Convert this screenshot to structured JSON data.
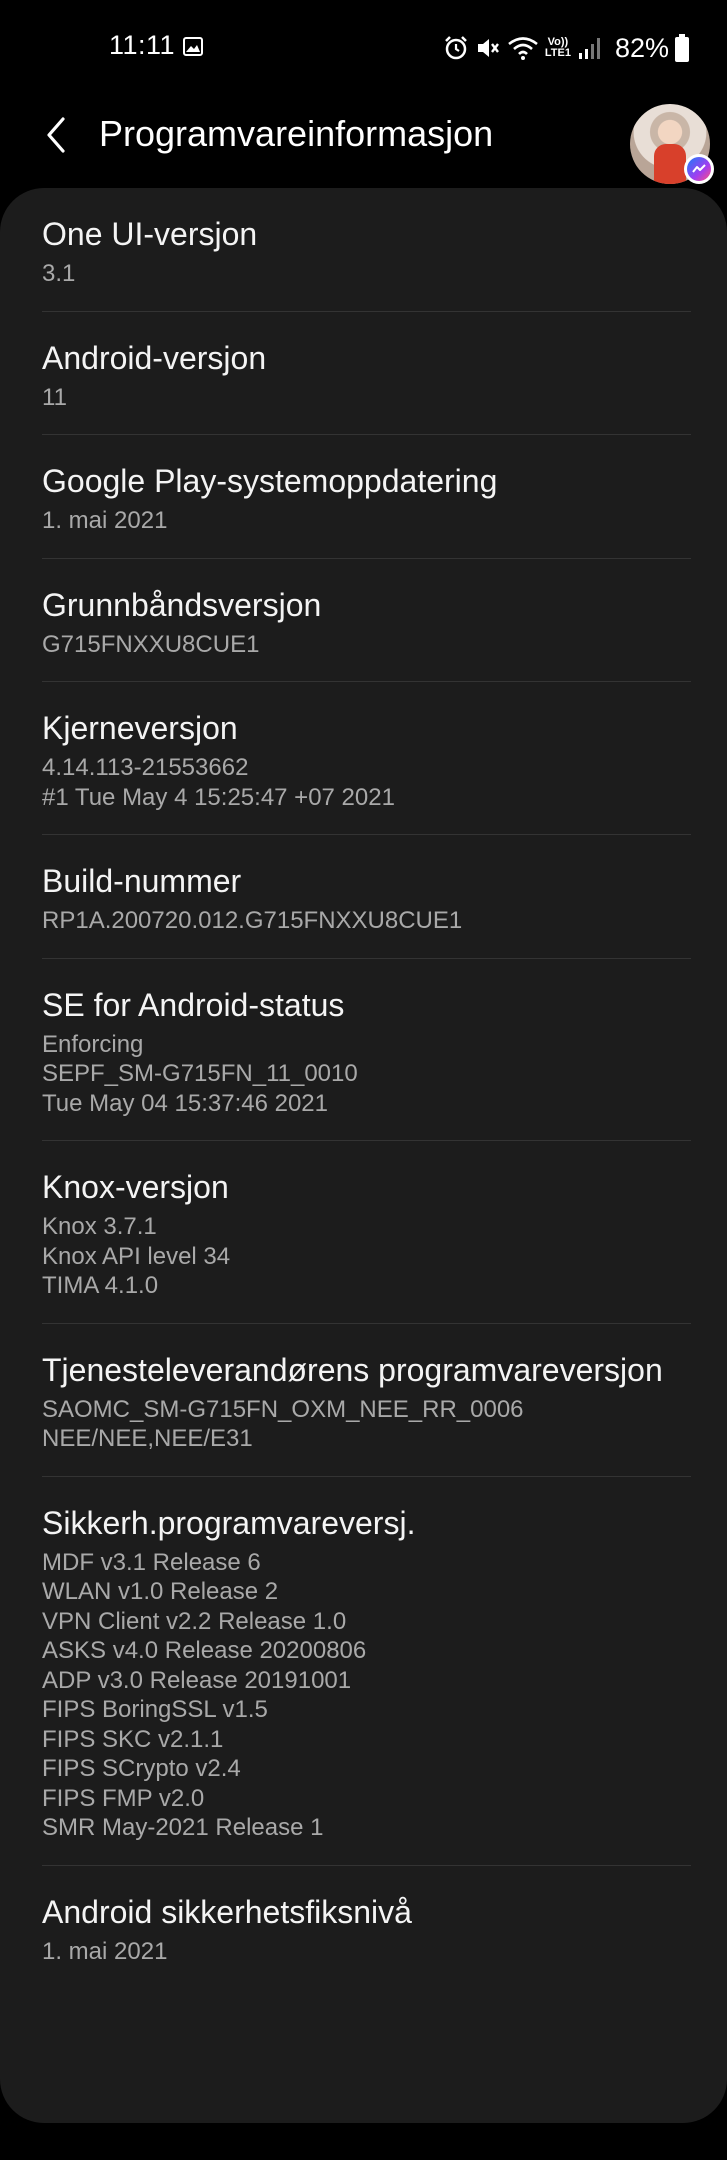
{
  "status_bar": {
    "time": "11:11",
    "battery_percent": "82%",
    "icons": [
      "gallery-icon",
      "alarm-icon",
      "mute-icon",
      "wifi-icon",
      "volte-icon",
      "signal-icon",
      "battery-icon"
    ],
    "volte_label_top": "Vo))",
    "volte_label_bottom": "LTE1"
  },
  "header": {
    "title": "Programvareinformasjon",
    "back_icon": "chevron-left-icon",
    "avatar_badge_icon": "messenger-icon"
  },
  "items": [
    {
      "title": "One UI-versjon",
      "lines": [
        "3.1"
      ]
    },
    {
      "title": "Android-versjon",
      "lines": [
        "11"
      ]
    },
    {
      "title": "Google Play-systemoppdatering",
      "lines": [
        "1. mai 2021"
      ]
    },
    {
      "title": "Grunnbåndsversjon",
      "lines": [
        "G715FNXXU8CUE1"
      ]
    },
    {
      "title": "Kjerneversjon",
      "lines": [
        "4.14.113-21553662",
        "#1 Tue May 4 15:25:47 +07 2021"
      ]
    },
    {
      "title": "Build-nummer",
      "lines": [
        "RP1A.200720.012.G715FNXXU8CUE1"
      ]
    },
    {
      "title": "SE for Android-status",
      "lines": [
        "Enforcing",
        "SEPF_SM-G715FN_11_0010",
        "Tue May 04 15:37:46 2021"
      ]
    },
    {
      "title": "Knox-versjon",
      "lines": [
        "Knox 3.7.1",
        "Knox API level 34",
        "TIMA 4.1.0"
      ]
    },
    {
      "title": "Tjenesteleverandørens programvareversjon",
      "lines": [
        "SAOMC_SM-G715FN_OXM_NEE_RR_0006",
        "NEE/NEE,NEE/E31"
      ]
    },
    {
      "title": "Sikkerh.programvareversj.",
      "lines": [
        "MDF v3.1 Release 6",
        "WLAN v1.0 Release 2",
        "VPN Client v2.2 Release 1.0",
        "ASKS v4.0 Release 20200806",
        "ADP v3.0 Release 20191001",
        "FIPS BoringSSL v1.5",
        "FIPS SKC v2.1.1",
        "FIPS SCrypto v2.4",
        "FIPS FMP v2.0",
        "SMR May-2021 Release 1"
      ]
    },
    {
      "title": "Android sikkerhetsfiksnivå",
      "lines": [
        "1. mai 2021"
      ]
    }
  ],
  "colors": {
    "background": "#000000",
    "card": "#1c1c1c",
    "title_text": "#f4f4f4",
    "subtitle_text": "#a9a9a9",
    "divider": "#333333"
  }
}
